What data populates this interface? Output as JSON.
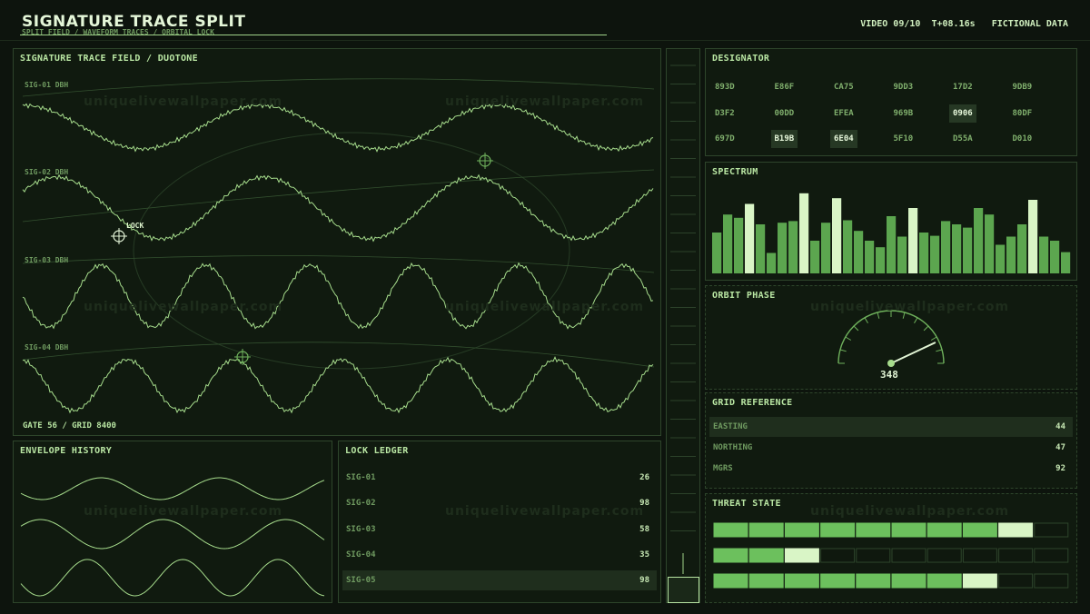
{
  "header": {
    "title": "SIGNATURE TRACE SPLIT",
    "subtitle": "SPLIT FIELD / WAVEFORM TRACES / ORBITAL LOCK",
    "video": "VIDEO 09/10",
    "time": "T+08.16s",
    "notice": "FICTIONAL DATA"
  },
  "watermark": "uniquelivewallpaper.com",
  "trace_field": {
    "title": "SIGNATURE TRACE FIELD / DUOTONE",
    "lanes": [
      {
        "label": "SIG-01 DBH"
      },
      {
        "label": "SIG-02 DBH"
      },
      {
        "label": "SIG-03 DBH"
      },
      {
        "label": "SIG-04 DBH"
      }
    ],
    "lock_label": "LOCK",
    "footer": "GATE 56 / GRID 8400"
  },
  "envelope": {
    "title": "ENVELOPE HISTORY"
  },
  "ledger": {
    "title": "LOCK LEDGER",
    "rows": [
      {
        "label": "SIG-01",
        "value": "26"
      },
      {
        "label": "SIG-02",
        "value": "98"
      },
      {
        "label": "SIG-03",
        "value": "58"
      },
      {
        "label": "SIG-04",
        "value": "35"
      },
      {
        "label": "SIG-05",
        "value": "98"
      }
    ]
  },
  "designator": {
    "title": "DESIGNATOR",
    "codes": [
      [
        "893D",
        "E86F",
        "CA75",
        "9DD3",
        "17D2",
        "9DB9"
      ],
      [
        "D3F2",
        "00DD",
        "EFEA",
        "969B",
        "0906",
        "80DF"
      ],
      [
        "697D",
        "B19B",
        "6E04",
        "5F10",
        "D55A",
        "D010"
      ]
    ],
    "highlighted": [
      "0906",
      "B19B",
      "6E04"
    ]
  },
  "spectrum": {
    "title": "SPECTRUM",
    "values": [
      50,
      72,
      68,
      85,
      60,
      25,
      62,
      64,
      98,
      40,
      62,
      92,
      65,
      52,
      40,
      32,
      70,
      45,
      80,
      50,
      46,
      64,
      60,
      56,
      80,
      72,
      35,
      45,
      60,
      90,
      45,
      40,
      26
    ],
    "bright_indices": [
      3,
      8,
      11,
      18,
      29
    ]
  },
  "orbit": {
    "title": "ORBIT PHASE",
    "value": "348",
    "fraction": 0.86
  },
  "grid_ref": {
    "title": "GRID REFERENCE",
    "rows": [
      {
        "label": "EASTING",
        "value": "44"
      },
      {
        "label": "NORTHING",
        "value": "47"
      },
      {
        "label": "MGRS",
        "value": "92"
      }
    ]
  },
  "threat": {
    "title": "THREAT STATE",
    "bars": [
      {
        "filled": 8,
        "bright": 1
      },
      {
        "filled": 2,
        "bright": 1
      },
      {
        "filled": 7,
        "bright": 1
      }
    ],
    "segments": 10
  },
  "colors": {
    "trace": "#a6dc8c",
    "bar": "#5ca64f",
    "bar_bright": "#d9f5c6",
    "border": "#2e452b"
  }
}
